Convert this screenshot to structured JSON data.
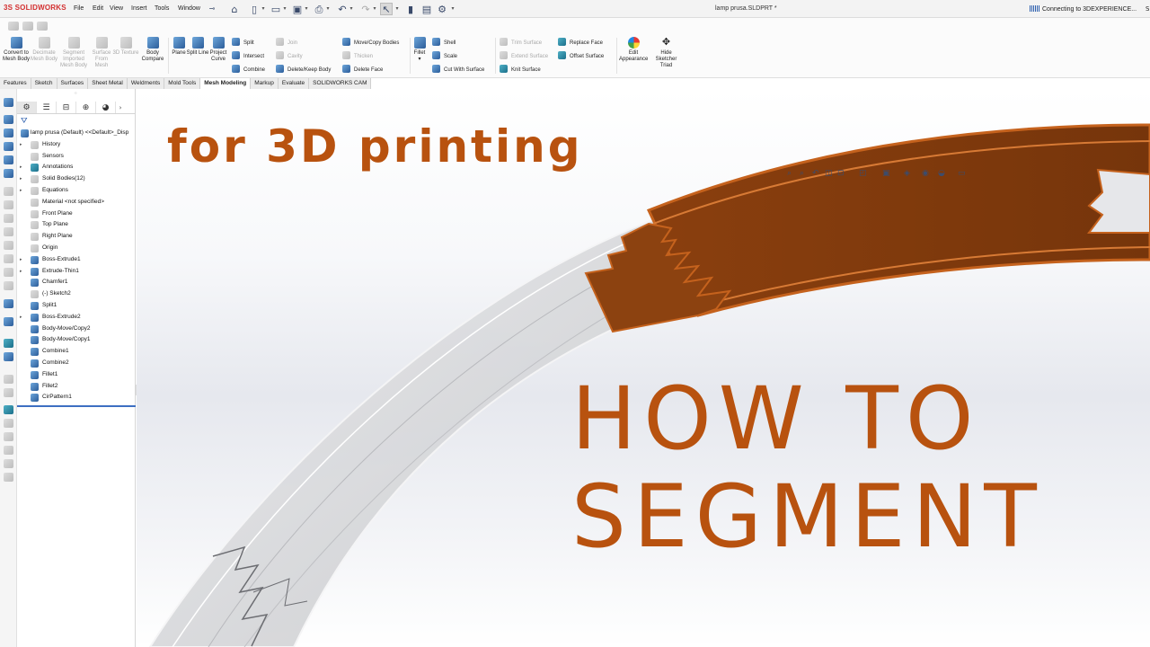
{
  "app": {
    "logo_prefix": "3S",
    "logo_name": "SOLIDWORKS"
  },
  "menu": [
    "File",
    "Edit",
    "View",
    "Insert",
    "Tools",
    "Window"
  ],
  "document_title": "lamp prusa.SLDPRT *",
  "connection_status": "Connecting to 3DEXPERIENCE...",
  "edge_letter": "S",
  "ribbon": {
    "large_tools": [
      {
        "label": "Convert to Mesh Body",
        "enabled": true
      },
      {
        "label": "Decimate Mesh Body",
        "enabled": false
      },
      {
        "label": "Segment Imported Mesh Body",
        "enabled": false
      },
      {
        "label": "Surface From Mesh",
        "enabled": false
      },
      {
        "label": "3D Texture",
        "enabled": false
      },
      {
        "label": "Body Compare",
        "enabled": true
      },
      {
        "label": "Plane",
        "enabled": true
      },
      {
        "label": "Split Line",
        "enabled": true
      },
      {
        "label": "Project Curve",
        "enabled": true
      }
    ],
    "group1": [
      {
        "label": "Split",
        "enabled": true
      },
      {
        "label": "Intersect",
        "enabled": true
      },
      {
        "label": "Combine",
        "enabled": true
      }
    ],
    "group2": [
      {
        "label": "Join",
        "enabled": false
      },
      {
        "label": "Cavity",
        "enabled": false
      },
      {
        "label": "Delete/Keep Body",
        "enabled": true
      }
    ],
    "group3": [
      {
        "label": "Move/Copy Bodies",
        "enabled": true
      },
      {
        "label": "Thicken",
        "enabled": false
      },
      {
        "label": "Delete Face",
        "enabled": true
      }
    ],
    "fillet": "Fillet",
    "group4": [
      {
        "label": "Shell",
        "enabled": true
      },
      {
        "label": "Scale",
        "enabled": true
      },
      {
        "label": "Cut With Surface",
        "enabled": true
      }
    ],
    "group5": [
      {
        "label": "Trim Surface",
        "enabled": false
      },
      {
        "label": "Extend Surface",
        "enabled": false
      },
      {
        "label": "Knit Surface",
        "enabled": true
      }
    ],
    "group6": [
      {
        "label": "Replace Face",
        "enabled": true
      },
      {
        "label": "Offset Surface",
        "enabled": true
      }
    ],
    "edit_appearance": "Edit Appearance",
    "hide_triad": "Hide Sketcher Triad"
  },
  "tabs": [
    "Features",
    "Sketch",
    "Surfaces",
    "Sheet Metal",
    "Weldments",
    "Mold Tools",
    "Mesh Modeling",
    "Markup",
    "Evaluate",
    "SOLIDWORKS CAM"
  ],
  "active_tab": "Mesh Modeling",
  "tree": [
    {
      "label": "lamp prusa (Default) <<Default>_Disp",
      "expand": false,
      "icon": "part"
    },
    {
      "label": "History",
      "expand": true,
      "icon": "folder"
    },
    {
      "label": "Sensors",
      "expand": false,
      "icon": "folder"
    },
    {
      "label": "Annotations",
      "expand": true,
      "icon": "annot"
    },
    {
      "label": "Solid Bodies(12)",
      "expand": true,
      "icon": "folder"
    },
    {
      "label": "Equations",
      "expand": true,
      "icon": "folder"
    },
    {
      "label": "Material <not specified>",
      "expand": false,
      "icon": "material"
    },
    {
      "label": "Front Plane",
      "expand": false,
      "icon": "plane"
    },
    {
      "label": "Top Plane",
      "expand": false,
      "icon": "plane"
    },
    {
      "label": "Right Plane",
      "expand": false,
      "icon": "plane"
    },
    {
      "label": "Origin",
      "expand": false,
      "icon": "origin"
    },
    {
      "label": "Boss-Extrude1",
      "expand": true,
      "icon": "feature"
    },
    {
      "label": "Extrude-Thin1",
      "expand": true,
      "icon": "feature"
    },
    {
      "label": "Chamfer1",
      "expand": false,
      "icon": "feature"
    },
    {
      "label": "(-) Sketch2",
      "expand": false,
      "icon": "sketch"
    },
    {
      "label": "Split1",
      "expand": false,
      "icon": "feature"
    },
    {
      "label": "Boss-Extrude2",
      "expand": true,
      "icon": "feature"
    },
    {
      "label": "Body-Move/Copy2",
      "expand": false,
      "icon": "feature"
    },
    {
      "label": "Body-Move/Copy1",
      "expand": false,
      "icon": "feature"
    },
    {
      "label": "Combine1",
      "expand": false,
      "icon": "feature"
    },
    {
      "label": "Combine2",
      "expand": false,
      "icon": "feature"
    },
    {
      "label": "Fillet1",
      "expand": false,
      "icon": "feature"
    },
    {
      "label": "Fillet2",
      "expand": false,
      "icon": "feature"
    },
    {
      "label": "CirPattern1",
      "expand": false,
      "icon": "feature"
    }
  ],
  "overlay": {
    "line1": "for 3D printing",
    "line2": "HOW TO",
    "line3": "SEGMENT",
    "color": "#b8520f"
  },
  "model_colors": {
    "orange_face": "#7e3a0c",
    "orange_edge": "#c5621d",
    "gray_face": "#d6d7da",
    "gray_edge": "#e8e9ec"
  }
}
